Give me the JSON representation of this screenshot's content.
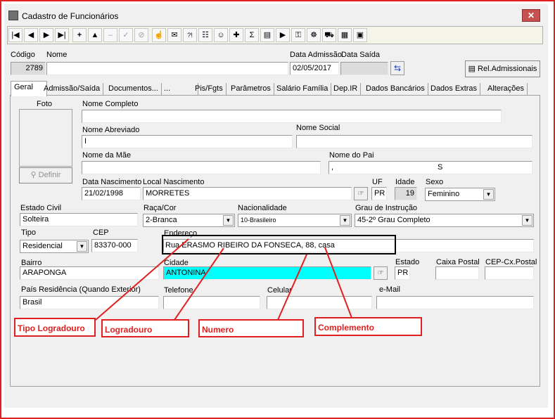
{
  "window": {
    "title": "Cadastro de Funcionários",
    "close": "✕"
  },
  "toolbar": {
    "buttons": [
      "|◀",
      "◀",
      "▶",
      "▶|",
      "+",
      "▲",
      "–",
      "✓",
      "⊘",
      "☝",
      "✉",
      "?!",
      "☷",
      "☺",
      "✚",
      "Σ",
      "▤",
      "▶",
      "⚿",
      "☸",
      "⛟",
      "▦",
      "▣"
    ]
  },
  "header": {
    "codigo_label": "Código",
    "codigo_value": "2789",
    "nome_label": "Nome",
    "nome_value": "",
    "admissao_label": "Data Admissão",
    "admissao_value": "02/05/2017",
    "saida_label": "Data Saída",
    "saida_value": "",
    "rel_button": "Rel.Admissionais"
  },
  "tabs": [
    "Geral",
    "Admissão/Saída",
    "Documentos...",
    "...",
    "Pis/Fgts",
    "Parâmetros",
    "Salário Família",
    "Dep.IR",
    "Dados Bancários",
    "Dados Extras",
    "Alterações"
  ],
  "form": {
    "foto_label": "Foto",
    "definir_button": "Definir",
    "nome_completo_label": "Nome Completo",
    "nome_completo_value": "",
    "nome_abreviado_label": "Nome Abreviado",
    "nome_abreviado_value": "I",
    "nome_social_label": "Nome Social",
    "nome_social_value": "",
    "nome_mae_label": "Nome da Mãe",
    "nome_mae_value": "",
    "nome_pai_label": "Nome do Pai",
    "nome_pai_value_a": ",",
    "nome_pai_value_b": "S",
    "data_nasc_label": "Data Nascimento",
    "data_nasc_value": "21/02/1998",
    "local_nasc_label": "Local Nascimento",
    "local_nasc_value": "MORRETES",
    "uf_label": "UF",
    "uf_value": "PR",
    "idade_label": "Idade",
    "idade_value": "19",
    "sexo_label": "Sexo",
    "sexo_value": "Feminino",
    "estado_civil_label": "Estado Civil",
    "estado_civil_value": "Solteira",
    "raca_label": "Raça/Cor",
    "raca_value": "2-Branca",
    "nacionalidade_label": "Nacionalidade",
    "nacionalidade_value": "10-Brasileiro",
    "grau_label": "Grau de Instrução",
    "grau_value": "45-2º Grau Completo",
    "tipo_label": "Tipo",
    "tipo_value": "Residencial",
    "cep_label": "CEP",
    "cep_value": "83370-000",
    "endereco_label": "Endereço",
    "endereco_value": "Rua ERASMO RIBEIRO DA FONSECA, 88, casa",
    "bairro_label": "Bairro",
    "bairro_value": "ARAPONGA",
    "cidade_label": "Cidade",
    "cidade_value": "ANTONINA",
    "estado_label": "Estado",
    "estado_value": "PR",
    "caixa_postal_label": "Caixa Postal",
    "caixa_postal_value": "",
    "cep_cx_label": "CEP-Cx.Postal",
    "cep_cx_value": "",
    "pais_label": "País Residência (Quando Exterior)",
    "pais_value": "Brasil",
    "telefone_label": "Telefone",
    "telefone_value": "",
    "celular_label": "Celular",
    "celular_value": "",
    "email_label": "e-Mail",
    "email_value": ""
  },
  "annotations": [
    "Tipo Logradouro",
    "Logradouro",
    "Numero",
    "Complemento"
  ],
  "colors": {
    "annotation": "#e02020",
    "highlight_field": "#00ffff",
    "toolbar_bg": "#f4f4e8"
  }
}
